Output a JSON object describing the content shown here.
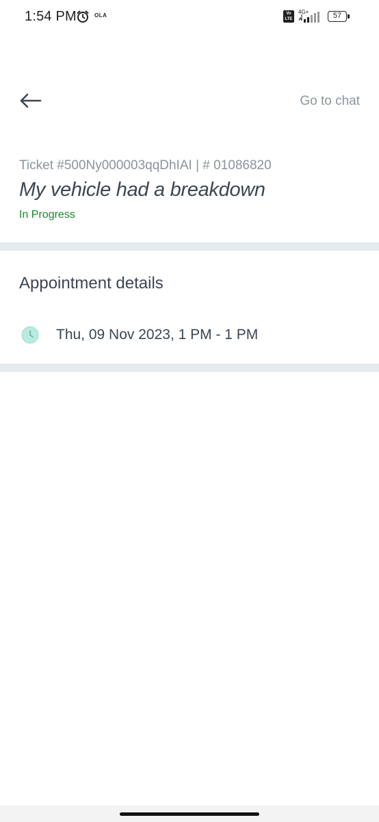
{
  "status_bar": {
    "time": "1:54 PM",
    "app_logo_text": "OLA",
    "volte_label": "Vo LTE",
    "network_label": "4G+",
    "battery_level": "57"
  },
  "header": {
    "back_icon": "arrow-left-icon",
    "chat_label": "Go to chat"
  },
  "ticket": {
    "id_line": "Ticket #500Ny000003qqDhIAI | # 01086820",
    "title": "My vehicle had a breakdown",
    "status": "In Progress",
    "status_color": "#17862b"
  },
  "appointment": {
    "section_title": "Appointment details",
    "icon": "clock-icon",
    "time": "Thu, 09 Nov 2023, 1 PM - 1 PM"
  },
  "colors": {
    "text_primary": "#3b4652",
    "text_muted": "#8a939b",
    "divider": "#e5eaee",
    "clock_fill": "#b8ecdf"
  }
}
